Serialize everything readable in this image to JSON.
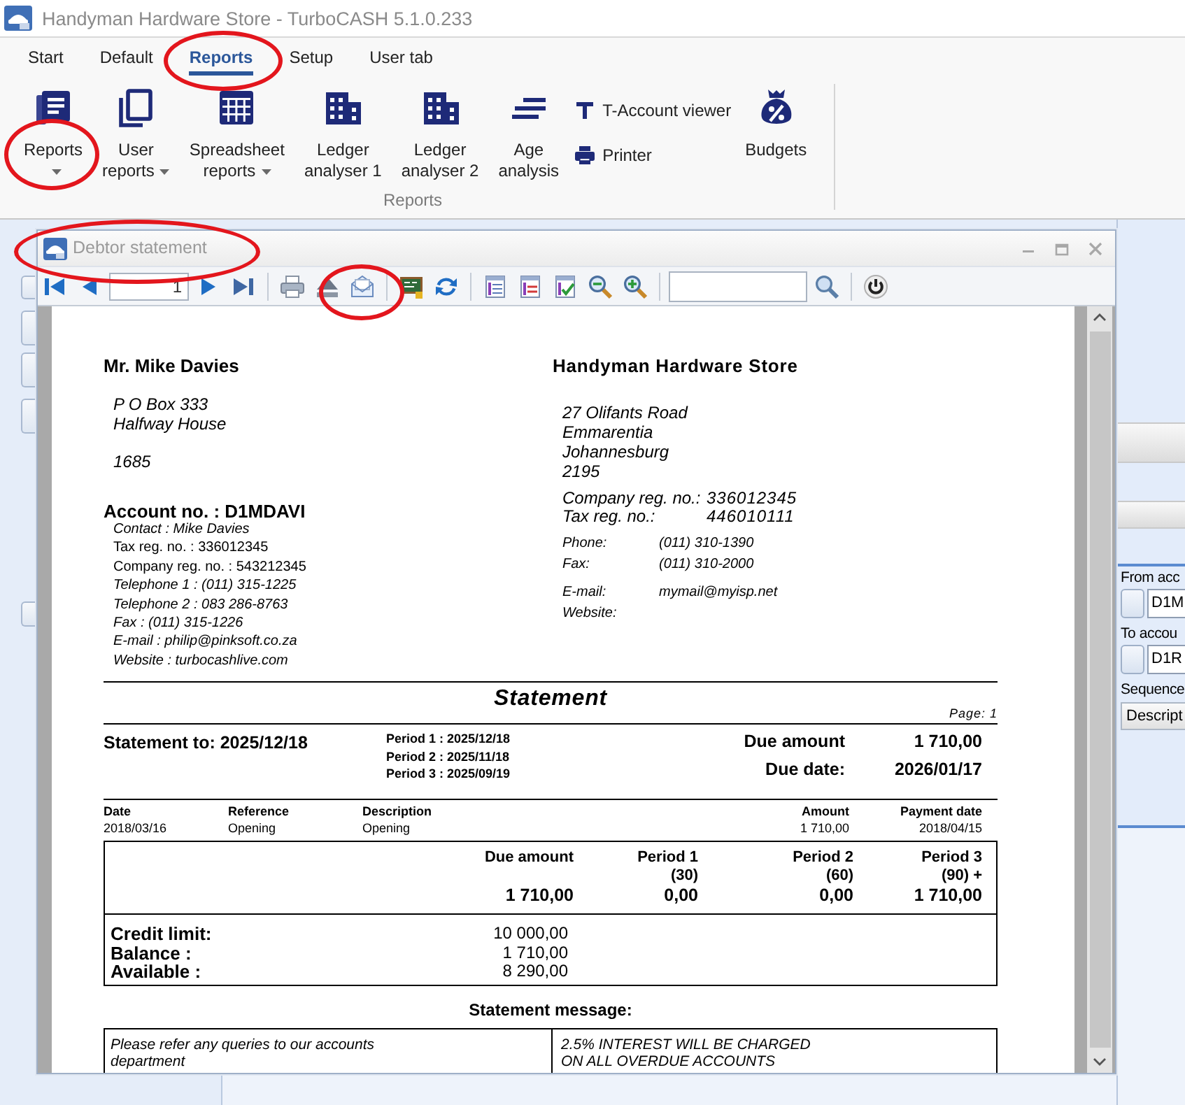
{
  "app_window": {
    "title": "Handyman Hardware Store - TurboCASH 5.1.0.233"
  },
  "ribbon": {
    "tabs": [
      {
        "label": "Start",
        "selected": false,
        "circled": false
      },
      {
        "label": "Default",
        "selected": false,
        "circled": false
      },
      {
        "label": "Reports",
        "selected": true,
        "circled": true
      },
      {
        "label": "Setup",
        "selected": false,
        "circled": false
      },
      {
        "label": "User tab",
        "selected": false,
        "circled": false
      }
    ],
    "group": {
      "label": "Reports",
      "buttons": [
        {
          "kind": "reports",
          "label": "Reports",
          "dropdown": true,
          "circled": true
        },
        {
          "kind": "custom",
          "label": "User reports",
          "dropdown": true,
          "circled": false
        },
        {
          "kind": "spreadsheet",
          "label": "Spreadsheet reports",
          "dropdown": true,
          "circled": false
        },
        {
          "kind": "ledger",
          "label": "Ledger analyser 1",
          "dropdown": false,
          "circled": false
        },
        {
          "kind": "ledger",
          "label": "Ledger analyser 2",
          "dropdown": false,
          "circled": false
        },
        {
          "kind": "ageing",
          "label": "Age analysis",
          "dropdown": false,
          "circled": false
        },
        {
          "kind": "stack",
          "circled": false,
          "items": [
            {
              "kind": "taccount",
              "label": "T-Account viewer"
            },
            {
              "kind": "printer",
              "label": "Printer"
            }
          ]
        },
        {
          "kind": "budgets",
          "label": "Budgets",
          "dropdown": false,
          "circled": false
        }
      ]
    }
  },
  "statement_window": {
    "title": "Debtor statement",
    "circled": true,
    "toolbar": {
      "groups": [
        {
          "items": [
            {
              "kind": "first",
              "circled": false
            },
            {
              "kind": "previous",
              "circled": false
            },
            {
              "kind": "page",
              "value": "1",
              "circled": false
            },
            {
              "kind": "next",
              "circled": false
            },
            {
              "kind": "last",
              "circled": false
            }
          ]
        },
        {
          "items": [
            {
              "kind": "print",
              "circled": false
            },
            {
              "kind": "eject",
              "circled": false
            },
            {
              "kind": "email",
              "circled": true
            }
          ]
        },
        {
          "items": [
            {
              "kind": "sheet",
              "circled": false
            },
            {
              "kind": "refresh",
              "circled": false
            }
          ]
        },
        {
          "items": [
            {
              "kind": "layout",
              "circled": false
            },
            {
              "kind": "layoutlines",
              "circled": false
            },
            {
              "kind": "layoutcheck",
              "circled": false
            },
            {
              "kind": "zoomout",
              "circled": false
            },
            {
              "kind": "zoomin",
              "circled": false
            }
          ]
        },
        {
          "items": [
            {
              "kind": "searchbox",
              "circled": false
            },
            {
              "kind": "search",
              "circled": false
            }
          ]
        },
        {
          "items": [
            {
              "kind": "power",
              "circled": false
            }
          ]
        }
      ]
    },
    "page": {
      "customer": {
        "name": "Mr. Mike Davies",
        "address": [
          "P O Box 333",
          "Halfway House"
        ],
        "postal_code": "1685",
        "account": "Account no. : D1MDAVI",
        "details": [
          {
            "kind": "contact",
            "text": "Contact : Mike Davies"
          },
          {
            "kind": "registration",
            "text": "Tax reg. no. : 336012345"
          },
          {
            "kind": "registration",
            "text": "Company reg. no. : 543212345"
          },
          {
            "kind": "phone",
            "text": "Telephone 1 : (011) 315-1225"
          },
          {
            "kind": "phone",
            "text": "Telephone 2 : 083 286-8763"
          },
          {
            "kind": "fax",
            "text": "Fax : (011) 315-1226"
          },
          {
            "kind": "email",
            "text": "E-mail : philip@pinksoft.co.za"
          },
          {
            "kind": "website",
            "text": "Website : turbocashlive.com"
          }
        ]
      },
      "company": {
        "name": "Handyman Hardware Store",
        "address": [
          "27 Olifants Road",
          "Emmarentia",
          "Johannesburg",
          "2195"
        ],
        "registrations": [
          {
            "label": "Company reg. no.:",
            "value": "336012345"
          },
          {
            "label": "Tax reg. no.:",
            "value": "446010111"
          }
        ],
        "contact_groups": [
          {
            "rows": [
              {
                "label": "Phone:",
                "value": "(011) 310-1390"
              },
              {
                "label": "Fax:",
                "value": "(011) 310-2000"
              }
            ]
          },
          {
            "rows": [
              {
                "label": "E-mail:",
                "value": "mymail@myisp.net"
              },
              {
                "label": "Website:"
              }
            ]
          }
        ]
      },
      "heading": "Statement",
      "page_number": "Page: 1",
      "statement_to": "Statement to: 2025/12/18",
      "periods": [
        "Period 1 : 2025/12/18",
        "Period 2 : 2025/11/18",
        "Period 3 : 2025/09/19"
      ],
      "due": [
        {
          "label": "Due amount",
          "value": "1 710,00"
        },
        {
          "label": "Due date:",
          "value": "2026/01/17"
        }
      ],
      "transactions": {
        "columns": [
          "Date",
          "Reference",
          "Description",
          "Amount",
          "Payment date"
        ],
        "rows": [
          [
            "2018/03/16",
            "Opening",
            "Opening",
            "1 710,00",
            "2018/04/15"
          ]
        ]
      },
      "ageing": {
        "columns": [
          {
            "label": "Due amount",
            "value": "1 710,00"
          },
          {
            "label": "Period 1",
            "sub": "(30)",
            "value": "0,00"
          },
          {
            "label": "Period 2",
            "sub": "(60)",
            "value": "0,00"
          },
          {
            "label": "Period 3",
            "sub": "(90) +",
            "value": "1 710,00"
          }
        ]
      },
      "credit": [
        {
          "label": "Credit limit:",
          "value": "10 000,00"
        },
        {
          "label": "Balance :",
          "value": "1 710,00"
        },
        {
          "label": "Available :",
          "value": "8 290,00"
        }
      ],
      "message_title": "Statement message:",
      "messages": [
        {
          "lines": [
            "Please refer any queries to our accounts",
            "department"
          ]
        },
        {
          "lines": [
            "2.5% INTEREST WILL BE CHARGED",
            "ON ALL OVERDUE ACCOUNTS"
          ]
        }
      ]
    }
  },
  "background_form": {
    "fields": [
      {
        "label": "From acc",
        "value": "D1M"
      },
      {
        "label": "To accou",
        "value": "D1R"
      }
    ],
    "sequence": {
      "label": "Sequence",
      "value": "Descript"
    }
  }
}
